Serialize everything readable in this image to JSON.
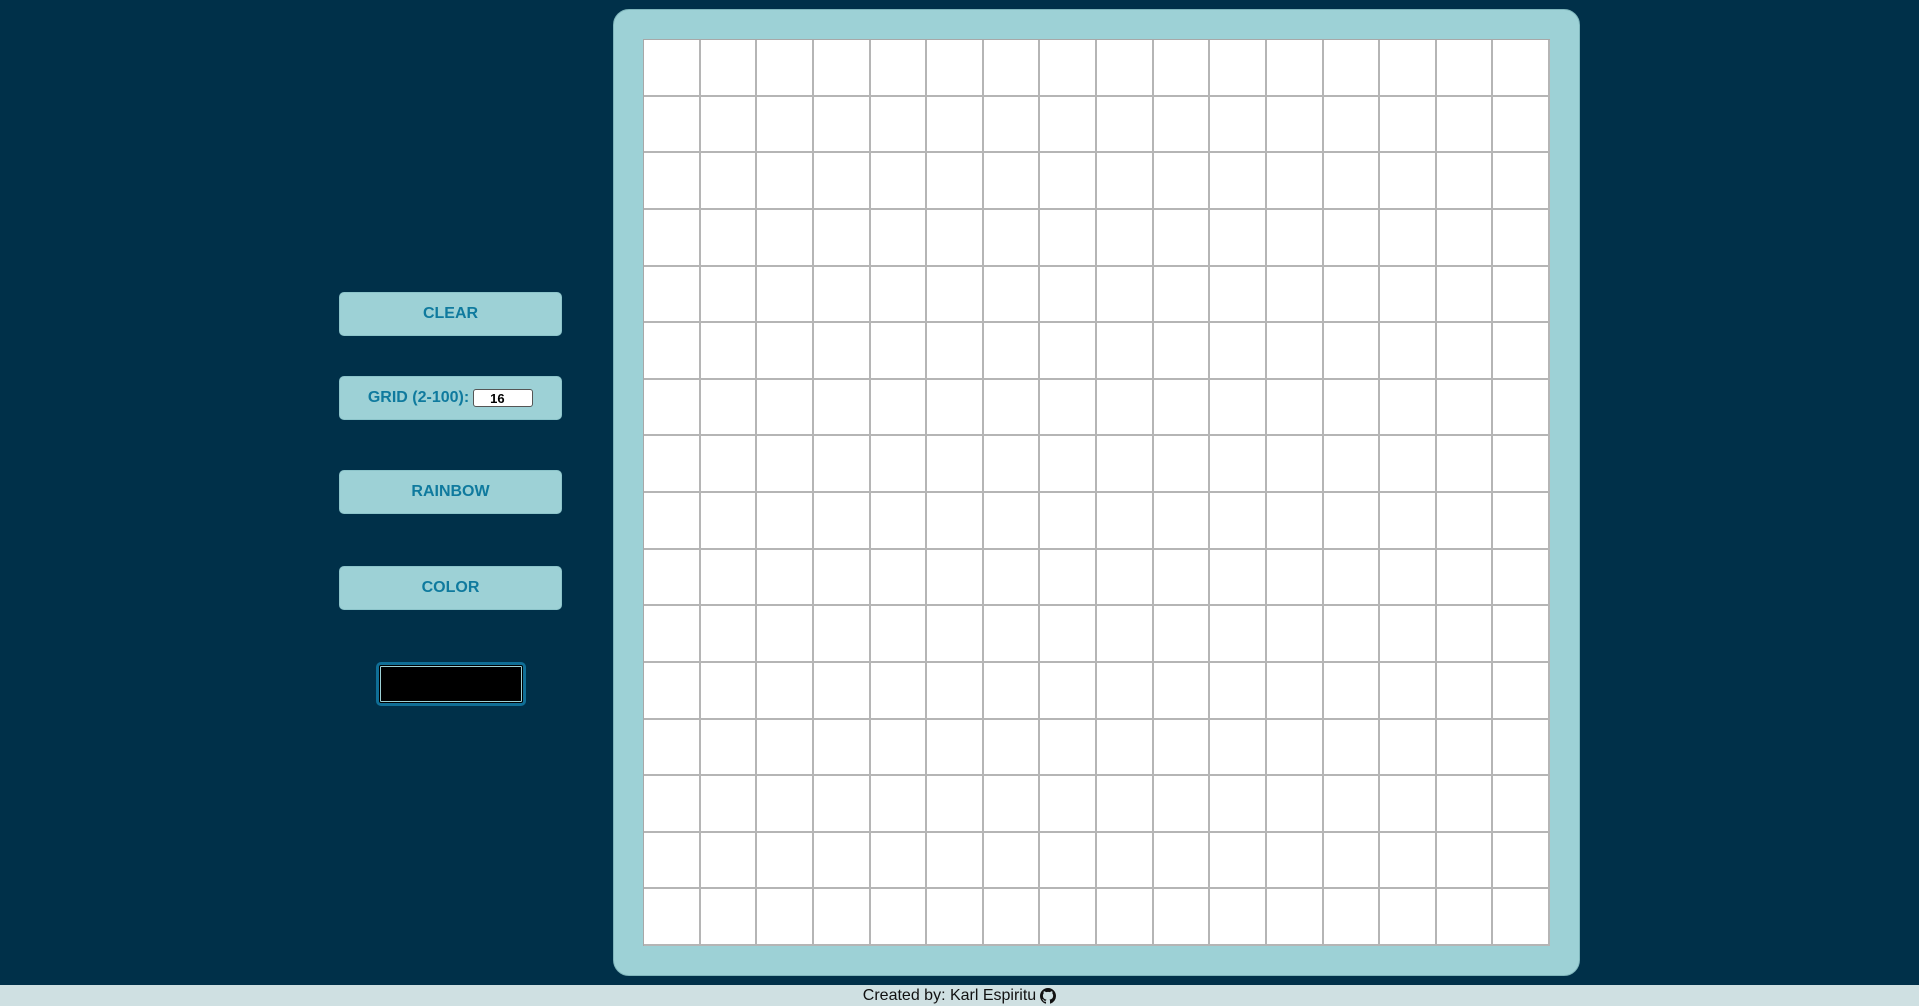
{
  "controls": {
    "clear_label": "CLEAR",
    "grid_label": "GRID (2-100):",
    "grid_value": "16",
    "rainbow_label": "RAINBOW",
    "color_label": "COLOR",
    "selected_color": "#000000"
  },
  "board": {
    "grid_size": 16,
    "cell_color": "#ffffff",
    "frame_color": "#9dd1d6"
  },
  "footer": {
    "credit_text": "Created by: Karl Espiritu",
    "icon": "github-icon"
  },
  "colors": {
    "background": "#003049",
    "button_bg": "#9dd1d6",
    "button_text": "#0f7a9e"
  }
}
